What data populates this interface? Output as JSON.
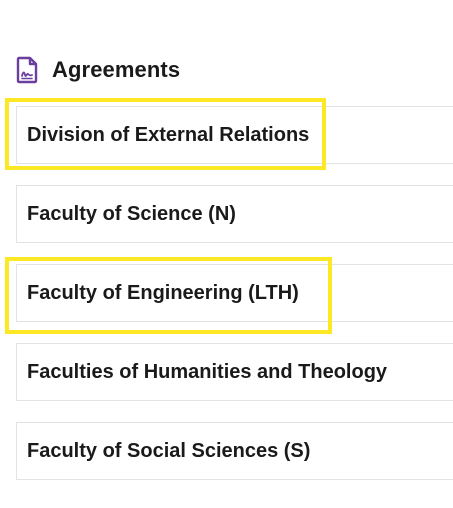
{
  "section": {
    "title": "Agreements",
    "icon": "document-signature-icon",
    "icon_color": "#6b3fa0"
  },
  "items": [
    {
      "label": "Division of External Relations",
      "highlighted": true
    },
    {
      "label": "Faculty of Science (N)",
      "highlighted": false
    },
    {
      "label": "Faculty of Engineering (LTH)",
      "highlighted": true
    },
    {
      "label": "Faculties of Humanities and Theology",
      "highlighted": false
    },
    {
      "label": "Faculty of Social Sciences (S)",
      "highlighted": false
    }
  ],
  "colors": {
    "highlight": "#fde826",
    "border": "#e3e3e3",
    "text": "#1a1a1a"
  }
}
